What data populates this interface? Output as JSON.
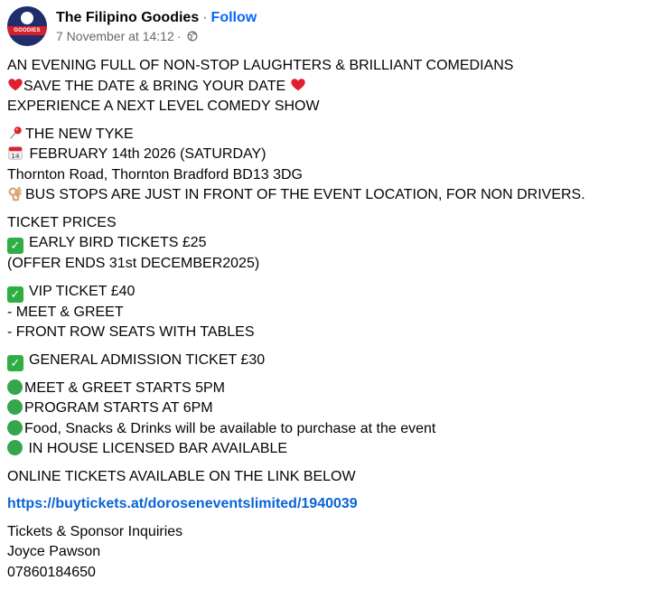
{
  "header": {
    "avatar_text": "GOODIES",
    "page_name": "The Filipino Goodies",
    "separator": "·",
    "follow_label": "Follow",
    "timestamp": "7 November at 14:12",
    "timestamp_separator": "·",
    "privacy_icon": "globe-icon"
  },
  "post": {
    "intro": [
      "AN EVENING FULL OF NON-STOP LAUGHTERS & BRILLIANT COMEDIANS",
      "SAVE THE DATE & BRING YOUR DATE",
      "EXPERIENCE A NEXT LEVEL COMEDY SHOW"
    ],
    "venue": {
      "name": "THE NEW TYKE",
      "date": "FEBRUARY 14th 2026 (SATURDAY)",
      "address": "Thornton Road, Thornton Bradford BD13 3DG",
      "bus_note": "BUS STOPS ARE JUST IN FRONT OF THE EVENT LOCATION, FOR NON DRIVERS."
    },
    "tickets": {
      "heading": "TICKET PRICES",
      "early_bird": "EARLY BIRD TICKETS £25",
      "early_bird_note": "(OFFER ENDS 31st DECEMBER2025)",
      "vip": "VIP TICKET £40",
      "vip_perk_1": "- MEET & GREET",
      "vip_perk_2": "- FRONT ROW SEATS WITH TABLES",
      "general": "GENERAL ADMISSION TICKET £30"
    },
    "schedule": [
      "MEET & GREET STARTS 5PM",
      "PROGRAM STARTS AT 6PM",
      "Food, Snacks & Drinks will be available to purchase at the event",
      " IN HOUSE LICENSED BAR AVAILABLE"
    ],
    "online_note": "ONLINE TICKETS AVAILABLE ON THE LINK BELOW",
    "link": "https://buytickets.at/doroseneventslimited/1940039",
    "contact": {
      "heading": "Tickets & Sponsor Inquiries",
      "name": "Joyce Pawson",
      "phone": "07860184650"
    }
  },
  "colors": {
    "text": "#050505",
    "secondary": "#65676b",
    "link": "#0864d4",
    "follow": "#0866ff"
  }
}
